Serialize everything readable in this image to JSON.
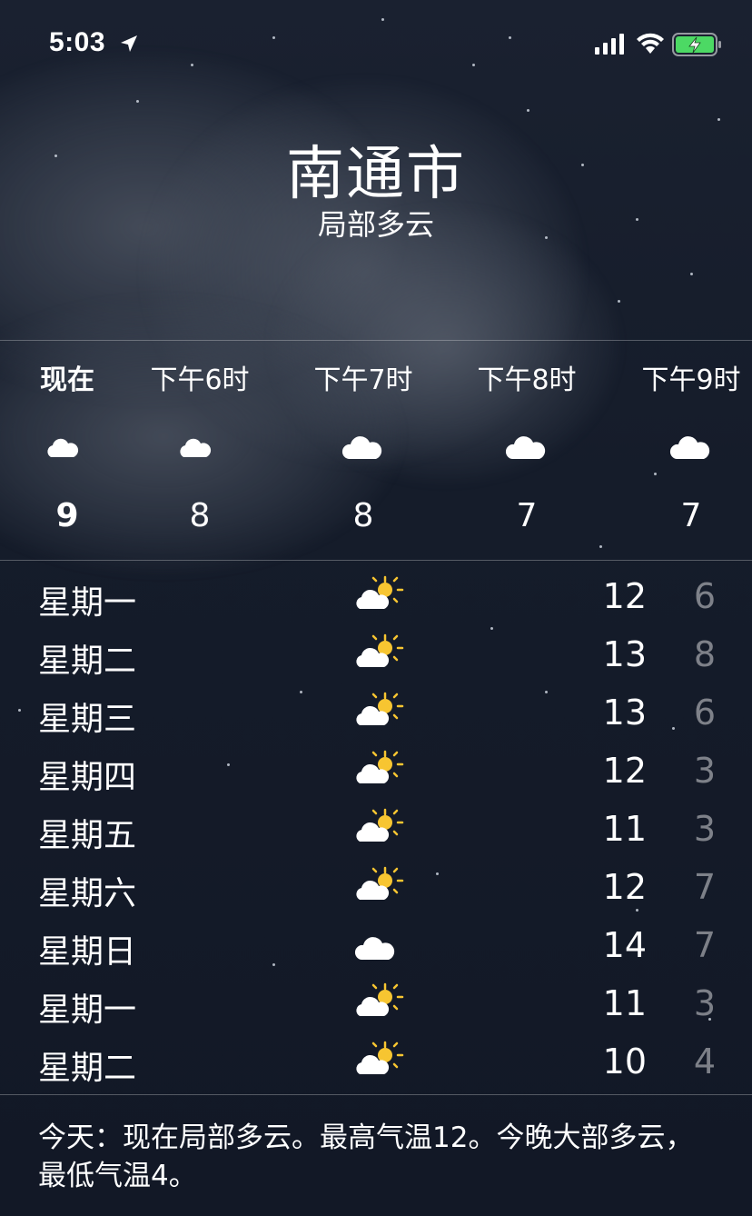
{
  "status_bar": {
    "time": "5:03",
    "icons": [
      "location-arrow-icon",
      "cellular-signal-icon",
      "wifi-icon",
      "battery-charging-icon"
    ],
    "battery_color": "#4cd964"
  },
  "header": {
    "city": "南通市",
    "condition": "局部多云"
  },
  "hourly": [
    {
      "label": "现在",
      "icon": "cloud-moon-icon",
      "temp": "9"
    },
    {
      "label": "下午6时",
      "icon": "cloud-moon-icon",
      "temp": "8"
    },
    {
      "label": "下午7时",
      "icon": "cloud-icon",
      "temp": "8"
    },
    {
      "label": "下午8时",
      "icon": "cloud-icon",
      "temp": "7"
    },
    {
      "label": "下午9时",
      "icon": "cloud-icon",
      "temp": "7"
    }
  ],
  "daily": [
    {
      "day": "星期一",
      "icon": "partly-sunny-icon",
      "high": "12",
      "low": "6"
    },
    {
      "day": "星期二",
      "icon": "partly-sunny-icon",
      "high": "13",
      "low": "8"
    },
    {
      "day": "星期三",
      "icon": "partly-sunny-icon",
      "high": "13",
      "low": "6"
    },
    {
      "day": "星期四",
      "icon": "partly-sunny-icon",
      "high": "12",
      "low": "3"
    },
    {
      "day": "星期五",
      "icon": "partly-sunny-icon",
      "high": "11",
      "low": "3"
    },
    {
      "day": "星期六",
      "icon": "partly-sunny-icon",
      "high": "12",
      "low": "7"
    },
    {
      "day": "星期日",
      "icon": "cloud-icon",
      "high": "14",
      "low": "7"
    },
    {
      "day": "星期一",
      "icon": "partly-sunny-icon",
      "high": "11",
      "low": "3"
    },
    {
      "day": "星期二",
      "icon": "partly-sunny-icon",
      "high": "10",
      "low": "4"
    }
  ],
  "summary": "今天：现在局部多云。最高气温12。今晚大部多云，最低气温4。",
  "colors": {
    "sun": "#f7c531",
    "background": "#151c2a"
  }
}
